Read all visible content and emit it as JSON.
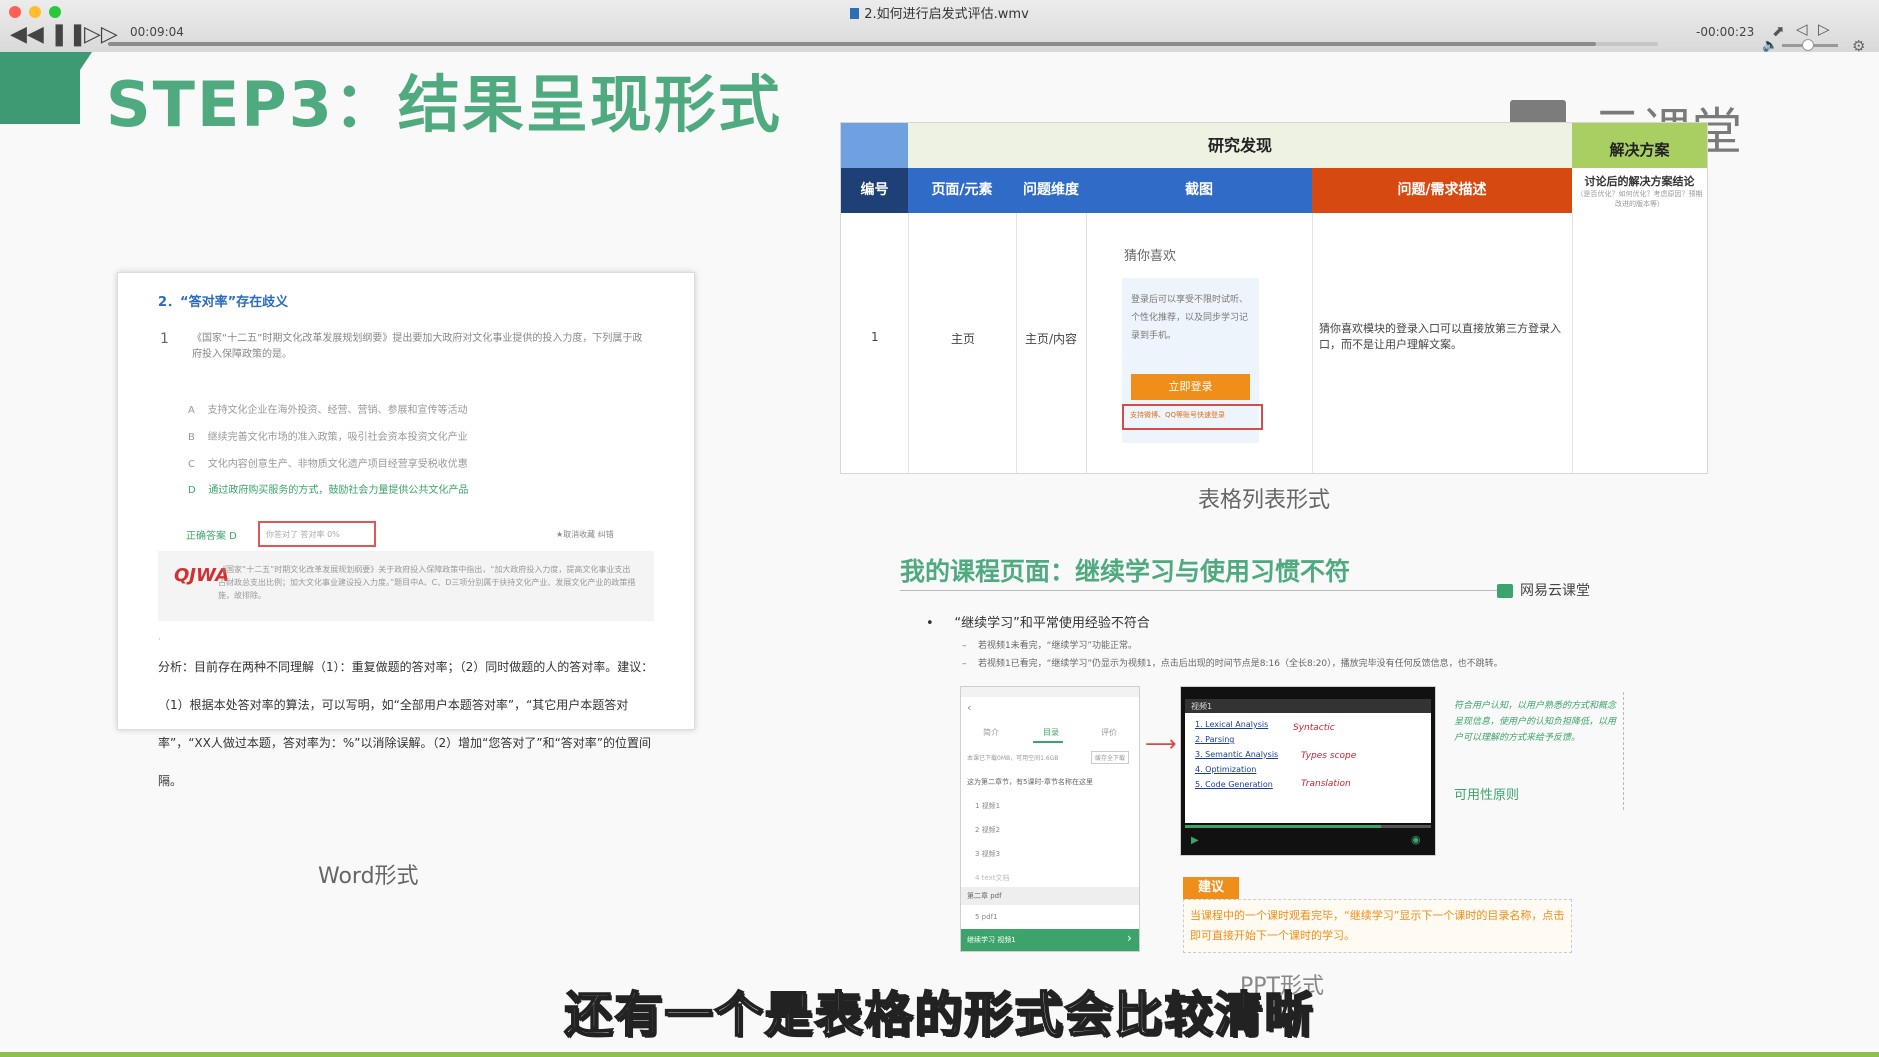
{
  "player": {
    "file_title": "2.如何进行启发式评估.wmv",
    "elapsed": "00:09:04",
    "remaining": "-00:00:23",
    "progress": 0.96,
    "volume": 0.45
  },
  "slide": {
    "title": "STEP3：结果呈现形式",
    "logo_text": "云课堂",
    "word_doc": {
      "heading": "2．“答对率”存在歧义",
      "q_number": "1",
      "q_text": "《国家“十二五”时期文化改革发展规划纲要》提出要加大政府对文化事业提供的投入力度，下列属于政府投入保障政策的是。",
      "options": [
        {
          "key": "A",
          "text": "支持文化企业在海外投资、经营、营销、参展和宣传等活动"
        },
        {
          "key": "B",
          "text": "继续完善文化市场的准入政策，吸引社会资本投资文化产业"
        },
        {
          "key": "C",
          "text": "文化内容创意生产、非物质文化遗产项目经营享受税收优惠"
        },
        {
          "key": "D",
          "text": "通过政府购买服务的方式，鼓励社会力量提供公共文化产品"
        }
      ],
      "answer_label": "正确答案 D",
      "answer_box_text": "你答对了  答对率 0%",
      "collect_text": "★取消收藏   纠错",
      "explain_logo": "QJWA",
      "explain_text": "《国家“十二五”时期文化改革发展规划纲要》关于政府投入保障政策中指出，“加大政府投入力度，提高文化事业支出占财政总支出比例；加大文化事业建设投入力度。”题目中A、C、D三项分别属于扶持文化产业、发展文化产业的政策措施，故排除。",
      "dot": "·",
      "analysis": "分析：目前存在两种不同理解（1）：重复做题的答对率；（2）同时做题的人的答对率。建议：（1）根据本处答对率的算法，可以写明，如“全部用户本题答对率”，“其它用户本题答对率”，“XX人做过本题，答对率为：%”以消除误解。（2）增加“您答对了”和“答对率”的位置间隔。",
      "caption": "Word形式"
    },
    "table": {
      "group_header": "研究发现",
      "solution_header": "解决方案",
      "columns": [
        "编号",
        "页面/元素",
        "问题维度",
        "截图",
        "问题/需求描述"
      ],
      "solution_sub": "讨论后的解决方案结论",
      "solution_note": "（是否优化？如何优化？考虑原因？预期改进的版本等）",
      "row": {
        "id": "1",
        "page": "主页",
        "dimension": "主页/内容",
        "mock_title": "猜你喜欢",
        "mock_text": "登录后可以享受不限时试听、个性化推荐，以及同步学习记录到手机。",
        "mock_login": "立即登录",
        "mock_alt": "支持微博、QQ等账号快速登录",
        "description": "猜你喜欢模块的登录入口可以直接放第三方登录入口，而不是让用户理解文案。"
      },
      "caption": "表格列表形式"
    },
    "course": {
      "title": "我的课程页面：继续学习与使用习惯不符",
      "brand": "网易云课堂",
      "bullet": "“继续学习”和平常使用经验不符合",
      "subs": [
        "若视频1未看完，“继续学习”功能正常。",
        "若视频1已看完，“继续学习”仍显示为视频1，点击后出现的时间节点是8:16（全长8:20），播放完毕没有任何反馈信息，也不跳转。"
      ],
      "phone1_tabs": [
        "简介",
        "目录",
        "评价"
      ],
      "phone1_progress": "本课已下载0MB，可用空间1.6GB",
      "phone1_download": "缓存全下载",
      "phone1_rows": [
        "这为第二章节，有5课时-章节名称在这里",
        "1  视频1",
        "2  视频2",
        "3  视频3",
        "4  text文档",
        "第二章  pdf",
        "5  pdf1"
      ],
      "phone1_footer": "继续学习   视频1",
      "phone2_title": "视频1",
      "phone2_items": [
        "1. Lexical Analysis",
        "2. Parsing",
        "3. Semantic Analysis",
        "4. Optimization",
        "5. Code Generation"
      ],
      "phone2_notes": [
        "Syntactic",
        "Types scope",
        "Translation"
      ],
      "note_text": "符合用户认知，以用户熟悉的方式和概念呈现信息，使用户的认知负担降低，以用户可以理解的方式来给予反馈。",
      "note_label": "可用性原则",
      "suggest_tag": "建议",
      "suggest_text": "当课程中的一个课时观看完毕，“继续学习”显示下一个课时的目录名称，点击即可直接开始下一个课时的学习。",
      "caption": "PPT形式"
    },
    "subtitle": "还有一个是表格的形式会比较清晰"
  }
}
